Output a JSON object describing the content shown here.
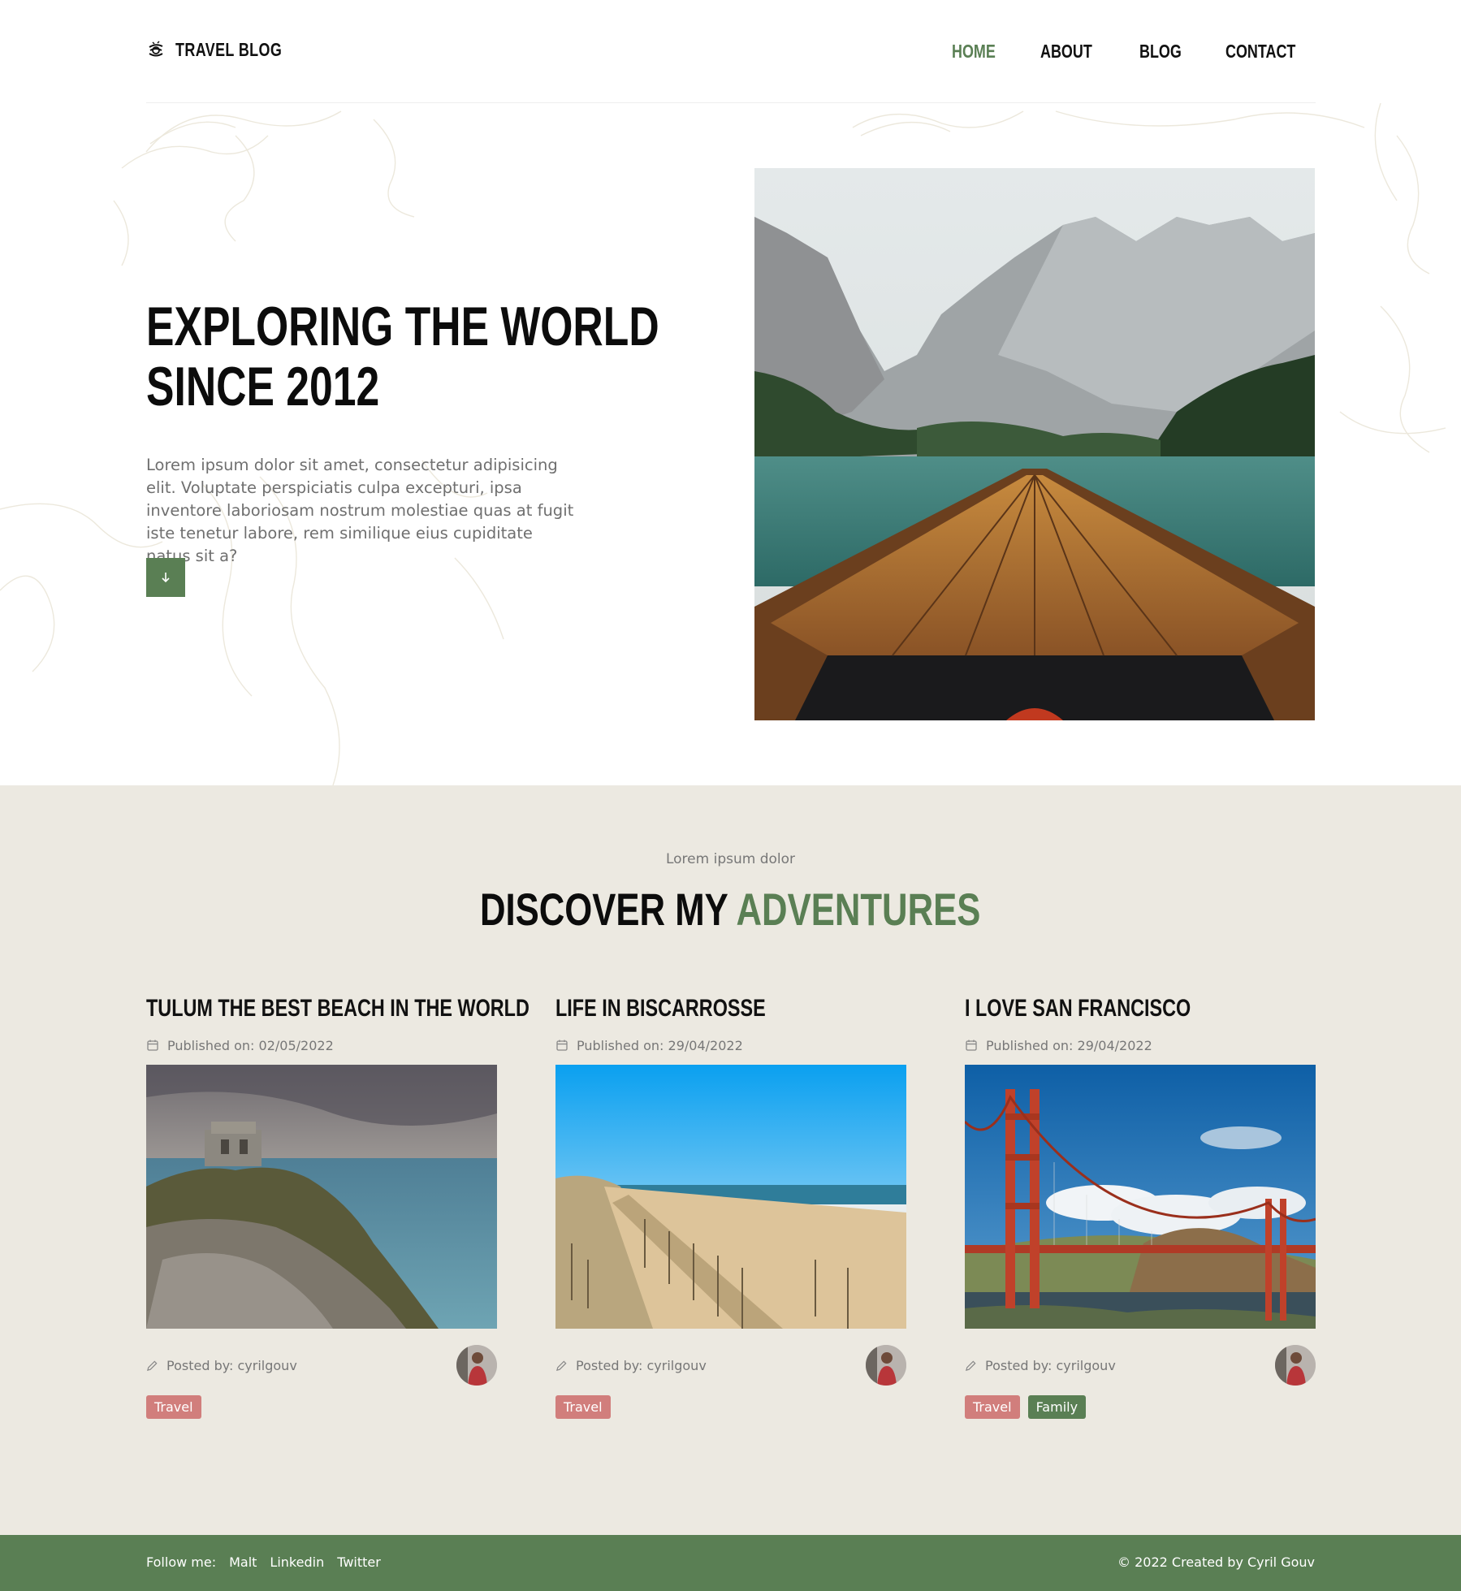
{
  "header": {
    "logo_icon": "globe-stack-icon",
    "logo_text": "TRAVEL BLOG",
    "nav": [
      {
        "label": "HOME",
        "active": true
      },
      {
        "label": "ABOUT",
        "active": false
      },
      {
        "label": "BLOG",
        "active": false
      },
      {
        "label": "CONTACT",
        "active": false
      }
    ]
  },
  "hero": {
    "title_line1": "EXPLORING THE WORLD",
    "title_line2": "SINCE 2012",
    "text": "Lorem ipsum dolor sit amet, consectetur adipisicing elit. Voluptate perspiciatis culpa excepturi, ipsa inventore laboriosam nostrum molestiae quas at fugit iste tenetur labore, rem similique eius cupiditate natus sit a?",
    "button_icon": "arrow-down-icon"
  },
  "section": {
    "kicker": "Lorem ipsum dolor",
    "title_dark": "DISCOVER MY",
    "title_green": "ADVENTURES"
  },
  "posts": [
    {
      "title": "TULUM THE BEST BEACH IN THE WORLD",
      "date": "Published on: 02/05/2022",
      "posted_by": "Posted by: cyrilgouv",
      "tags": [
        {
          "label": "Travel",
          "kind": "travel"
        }
      ]
    },
    {
      "title": "LIFE IN BISCARROSSE",
      "date": "Published on: 29/04/2022",
      "posted_by": "Posted by: cyrilgouv",
      "tags": [
        {
          "label": "Travel",
          "kind": "travel"
        }
      ]
    },
    {
      "title": "I LOVE SAN FRANCISCO",
      "date": "Published on: 29/04/2022",
      "posted_by": "Posted by: cyrilgouv",
      "tags": [
        {
          "label": "Travel",
          "kind": "travel"
        },
        {
          "label": "Family",
          "kind": "family"
        }
      ]
    }
  ],
  "footer": {
    "follow_label": "Follow me:",
    "links": [
      "Malt",
      "Linkedin",
      "Twitter"
    ],
    "copyright": "© 2022 Created by Cyril Gouv"
  },
  "colors": {
    "accent_green": "#5a7f54",
    "tag_pink": "#d17e7c",
    "section_bg": "#ece9e1"
  }
}
